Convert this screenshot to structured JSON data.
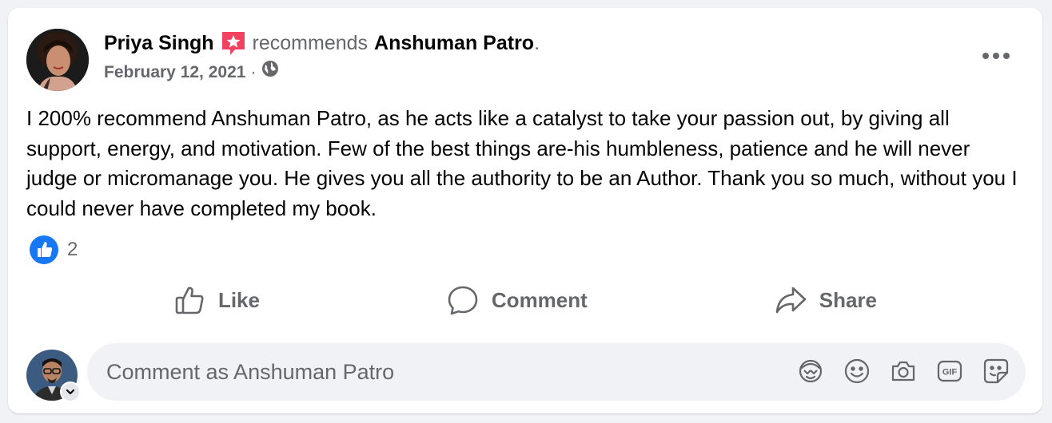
{
  "post": {
    "author": "Priya Singh",
    "verb": "recommends",
    "page": "Anshuman Patro",
    "period": ".",
    "date": "February 12, 2021",
    "separator": "·",
    "privacy_icon": "globe-icon",
    "body": "I 200% recommend Anshuman Patro, as he acts like a catalyst to take your passion out, by giving all support, energy, and motivation. Few of the best things are-his humbleness, patience and he will never judge or micromanage you. He gives you all the authority to be an Author. Thank you so much, without you I could never have completed my book.",
    "reaction_count": "2"
  },
  "actions": {
    "like": "Like",
    "comment": "Comment",
    "share": "Share"
  },
  "composer": {
    "placeholder": "Comment as Anshuman Patro"
  },
  "colors": {
    "accent": "#1877f2",
    "recommend_badge": "#f3425f",
    "secondary_text": "#65676b",
    "background": "#f0f2f5"
  }
}
